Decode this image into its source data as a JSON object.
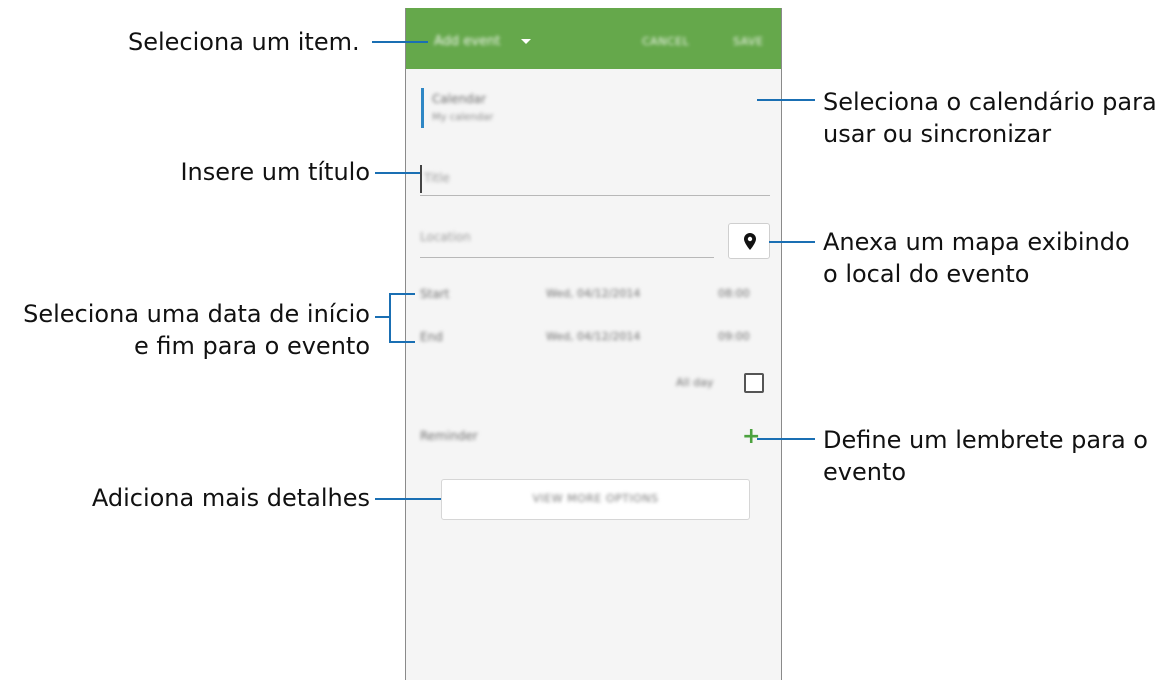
{
  "app": {
    "header": {
      "selector_label": "Add event",
      "cancel_label": "CANCEL",
      "save_label": "SAVE",
      "accent_color": "#65a84b"
    },
    "calendar": {
      "title": "Calendar",
      "account": "My calendar"
    },
    "title_field": {
      "placeholder": "Title"
    },
    "location_field": {
      "placeholder": "Location",
      "map_icon": "map-pin-icon"
    },
    "start": {
      "label": "Start",
      "date": "Wed, 04/12/2014",
      "time": "08:00"
    },
    "end": {
      "label": "End",
      "date": "Wed, 04/12/2014",
      "time": "09:00"
    },
    "all_day": {
      "label": "All day",
      "checked": false
    },
    "reminder": {
      "label": "Reminder",
      "add_icon": "plus-icon"
    },
    "details_button": {
      "label": "VIEW MORE OPTIONS"
    }
  },
  "annotations": {
    "select_item": "Seleciona um item.",
    "calendar_line1": "Seleciona o calendário para",
    "calendar_line2": "usar ou sincronizar",
    "title": "Insere um título",
    "map_line1": "Anexa um mapa exibindo",
    "map_line2": "o local do evento",
    "dates_line1": "Seleciona uma data de início",
    "dates_line2": "e fim para o evento",
    "reminder_line1": "Define um lembrete para o",
    "reminder_line2": "evento",
    "details": "Adiciona mais detalhes"
  }
}
